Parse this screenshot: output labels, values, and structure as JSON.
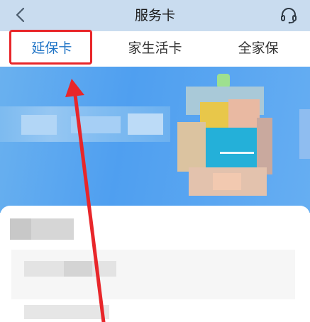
{
  "header": {
    "title": "服务卡",
    "back_icon": "chevron-left-icon",
    "support_icon": "headset-icon"
  },
  "tabs": [
    {
      "label": "延保卡",
      "active": true
    },
    {
      "label": "家生活卡",
      "active": false
    },
    {
      "label": "全家保",
      "active": false
    }
  ],
  "colors": {
    "nav_bg": "#c9dcef",
    "active_tab": "#1f74c6",
    "annotation_red": "#e8262a",
    "banner_blue": "#4f9ff0"
  }
}
